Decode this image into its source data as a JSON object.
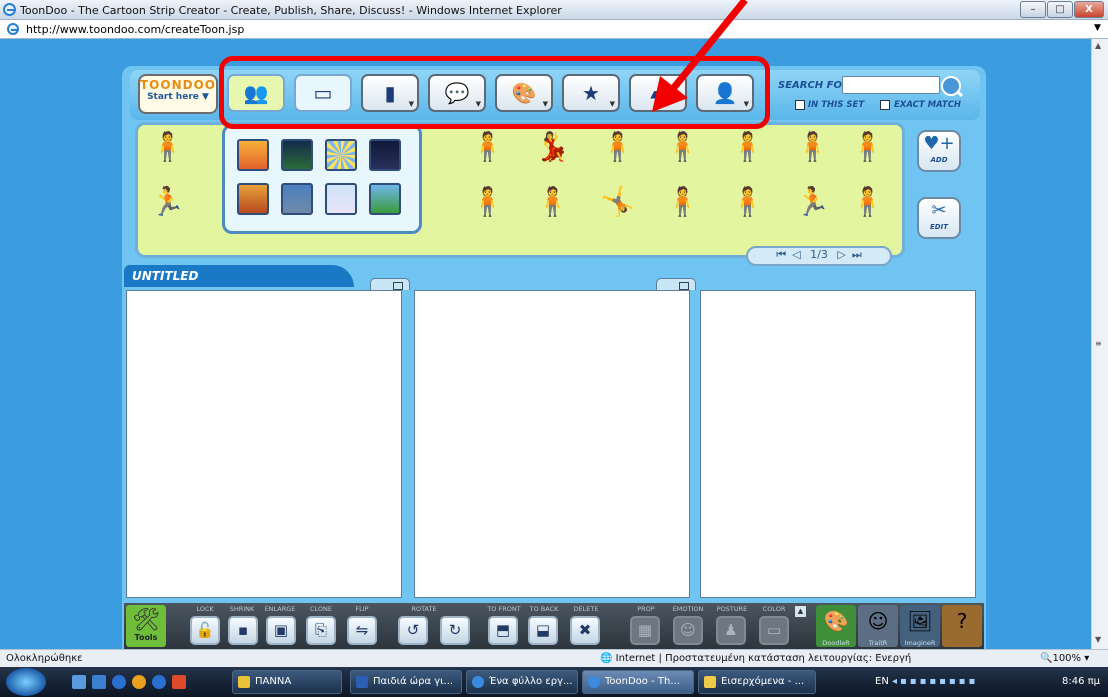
{
  "window": {
    "title": "ToonDoo - The Cartoon Strip Creator - Create, Publish, Share, Discuss! - Windows Internet Explorer",
    "url": "http://www.toondoo.com/createToon.jsp",
    "minimize": "–",
    "maximize": "□",
    "close": "X"
  },
  "app": {
    "logo_brand": "TOONDOO",
    "logo_start": "Start here ▼",
    "categories": [
      {
        "icon": "characters-icon",
        "glyph": "👥"
      },
      {
        "icon": "backgrounds-icon",
        "glyph": "▭"
      },
      {
        "icon": "props-icon",
        "glyph": "▮"
      },
      {
        "icon": "speech-bubbles-icon",
        "glyph": "💬"
      },
      {
        "icon": "art-icon",
        "glyph": "🎨"
      },
      {
        "icon": "special-effects-icon",
        "glyph": "★"
      },
      {
        "icon": "text-icon",
        "glyph": "▰"
      },
      {
        "icon": "my-stuff-icon",
        "glyph": "👤"
      }
    ],
    "search": {
      "label": "SEARCH FOR",
      "value": "",
      "in_this_set": "IN THIS SET",
      "exact_match": "EXACT MATCH"
    },
    "tray": {
      "add_label": "ADD",
      "edit_label": "EDIT",
      "page": "1/3"
    },
    "strip_title": "UNTITLED",
    "tools_label": "Tools",
    "tool_labels": [
      "LOCK",
      "SHRINK",
      "ENLARGE",
      "CLONE",
      "FLIP",
      "ROTATE",
      "TO FRONT",
      "TO BACK",
      "DELETE",
      "PROP",
      "EMOTION",
      "POSTURE",
      "COLOR"
    ],
    "tool_glyphs": [
      "🔓",
      "▪",
      "▣",
      "⎘",
      "⇋",
      "↺",
      "↻",
      "⬒",
      "⬓",
      "✖",
      "▦",
      "☺",
      "♟",
      "▭"
    ],
    "extras": [
      "DoodleR",
      "TraitR",
      "ImagineR",
      "Help"
    ],
    "accent_red": "#f20000",
    "tray_green": "#e3f59e",
    "app_blue": "#6fc4f2"
  },
  "status": {
    "left": "Ολοκληρώθηκε",
    "zone": "Internet | Προστατευμένη κατάσταση λειτουργίας: Ενεργή",
    "zoom": "100%"
  },
  "taskbar": {
    "tasks": [
      {
        "label": "ΠΑΝΝΑ",
        "active": false
      },
      {
        "label": "Παιδιά ώρα γι...",
        "active": false
      },
      {
        "label": "Ένα φύλλο εργ...",
        "active": false
      },
      {
        "label": "ToonDoo - Th...",
        "active": true
      },
      {
        "label": "Εισερχόμενα - ...",
        "active": false
      }
    ],
    "lang": "EN",
    "clock": "8:46 πμ"
  }
}
